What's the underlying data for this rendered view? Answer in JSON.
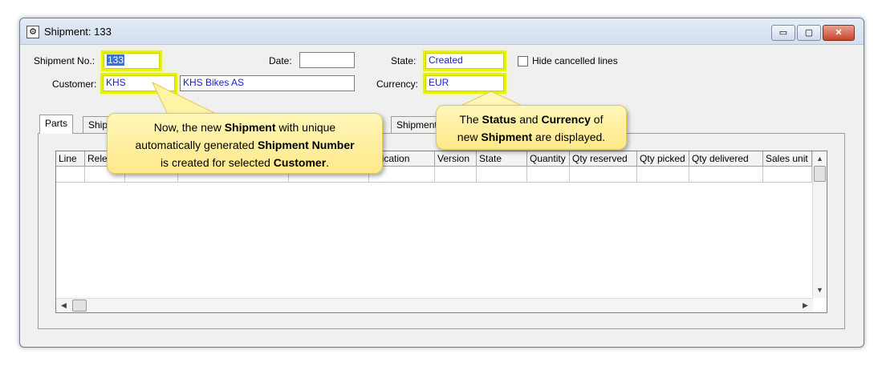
{
  "window": {
    "title": "Shipment: 133",
    "buttons": {
      "minimize": "▭",
      "maximize": "▢",
      "close": "✕"
    }
  },
  "form": {
    "shipment_no_label": "Shipment No.:",
    "shipment_no_value": "133",
    "date_label": "Date:",
    "date_value": "",
    "state_label": "State:",
    "state_value": "Created",
    "hide_cancelled_label": "Hide cancelled lines",
    "hide_cancelled_checked": false,
    "customer_label": "Customer:",
    "customer_code": "KHS",
    "customer_name": "KHS Bikes AS",
    "currency_label": "Currency:",
    "currency_value": "EUR"
  },
  "tabs": [
    {
      "label": "Parts",
      "active": true
    },
    {
      "label": "Ship"
    },
    {
      "label": "Shipment"
    }
  ],
  "grid": {
    "columns": [
      "Line",
      "Rele",
      "",
      "",
      "",
      "dification",
      "Version",
      "State",
      "Quantity",
      "Qty reserved",
      "Qty picked",
      "Qty delivered",
      "Sales unit"
    ]
  },
  "callouts": {
    "left": {
      "p1": "Now, the new ",
      "b1": "Shipment",
      "p2": " with unique",
      "p3": "automatically generated ",
      "b2": "Shipment Number",
      "p4": "is created for selected ",
      "b3": "Customer",
      "p5": "."
    },
    "right": {
      "p1": "The ",
      "b1": "Status",
      "p2": " and ",
      "b2": "Currency",
      "p3": " of",
      "p4": "new ",
      "b3": "Shipment",
      "p5": " are displayed."
    }
  },
  "colors": {
    "highlight": "#e6f200",
    "callout": "#ffe98a",
    "field_text": "#1b1bd6"
  }
}
